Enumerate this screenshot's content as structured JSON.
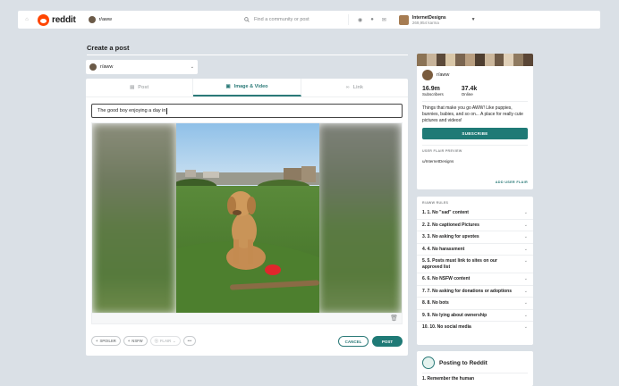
{
  "header": {
    "brand": "reddit",
    "community": "r/aww",
    "search_placeholder": "Find a community or post",
    "user": {
      "name": "InternetDesigns",
      "karma": "269,954 karma"
    }
  },
  "page": {
    "title": "Create a post"
  },
  "post_form": {
    "community_selected": "r/aww",
    "tabs": [
      {
        "label": "Post",
        "icon": "document-icon",
        "active": false
      },
      {
        "label": "Image & Video",
        "icon": "image-icon",
        "active": true
      },
      {
        "label": "Link",
        "icon": "link-icon",
        "active": false
      }
    ],
    "title_value": "The good boy enjoying a day in",
    "flair_buttons": [
      {
        "label": "SPOILER",
        "prefix": "+"
      },
      {
        "label": "NSFW",
        "prefix": "+"
      },
      {
        "label": "FLAIR",
        "prefix": "⦿"
      },
      {
        "label": "•••",
        "prefix": ""
      }
    ],
    "cancel_label": "CANCEL",
    "post_label": "POST"
  },
  "community_card": {
    "name": "r/aww",
    "subscribers_value": "16.9m",
    "subscribers_label": "Subscribers",
    "online_value": "37.4k",
    "online_label": "Online",
    "description": "Things that make you go AWW! Like puppies, bunnies, babies, and so on... A place for really cute pictures and videos!",
    "subscribe_label": "SUBSCRIBE",
    "flair_header": "USER FLAIR PREVIEW",
    "flair_user": "u/InternetDesigns",
    "add_flair_label": "ADD USER FLAIR"
  },
  "rules_card": {
    "header": "R/AWW RULES",
    "rules": [
      "1. 1. No \"sad\" content",
      "2. 2. No captioned Pictures",
      "3. 3. No asking for upvotes",
      "4. 4. No harassment",
      "5. 5. Posts must link to sites on our approved list",
      "6. 6. No NSFW content",
      "7. 7. No asking for donations or adoptions",
      "8. 8. No bots",
      "9. 9. No lying about ownership",
      "10. 10. No social media"
    ]
  },
  "posting_card": {
    "title": "Posting to Reddit",
    "first_item": "1. Remember the human"
  },
  "colors": {
    "accent": "#1f7a76",
    "background": "#dae0e6",
    "reddit_orange": "#ff4500"
  }
}
